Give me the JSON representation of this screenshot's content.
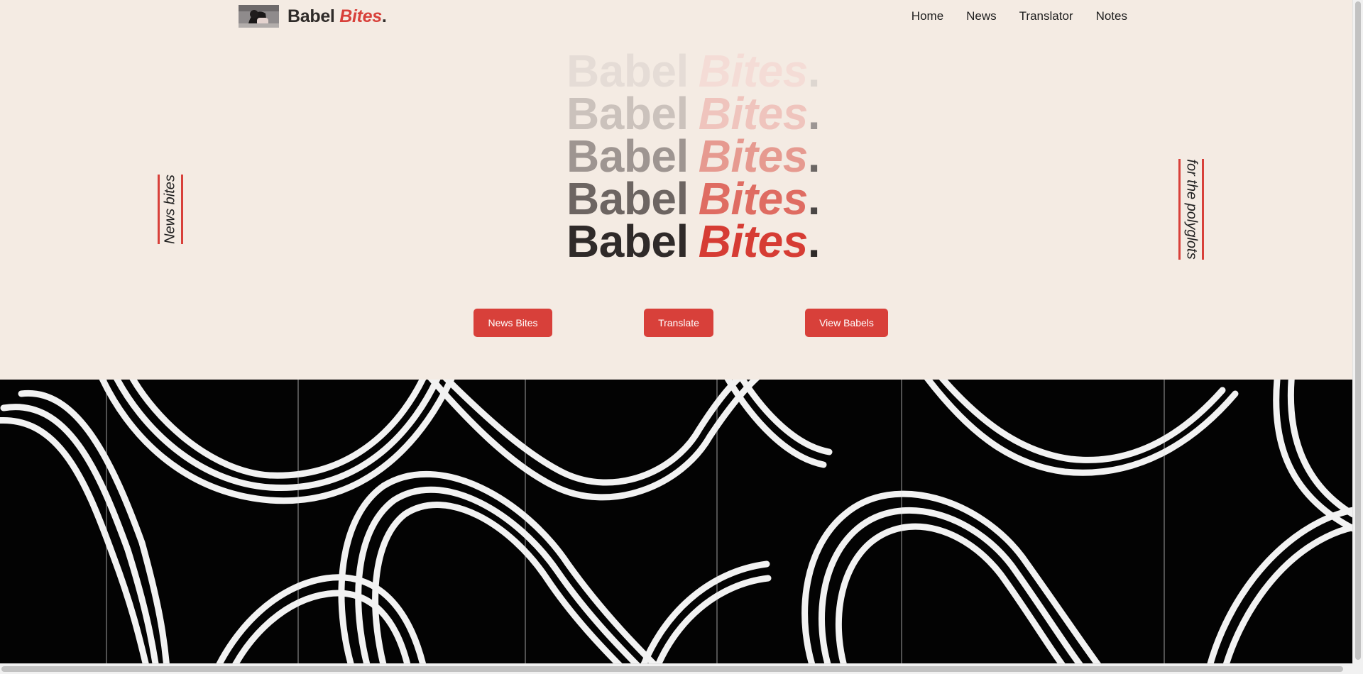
{
  "brand": {
    "name": "Babel",
    "accent": "Bites",
    "dot": "."
  },
  "nav": {
    "items": [
      "Home",
      "News",
      "Translator",
      "Notes"
    ]
  },
  "hero": {
    "word1": "Babel",
    "word2": "Bites",
    "dot": "."
  },
  "side_tags": {
    "left": "News bites",
    "right": "for the polyglots"
  },
  "buttons": {
    "news": "News Bites",
    "translate": "Translate",
    "babels": "View Babels"
  },
  "colors": {
    "accent": "#d8403a",
    "background": "#f4ebe3",
    "text": "#2f2b29"
  },
  "icons": {
    "logo_thumbnail": "cat-photo-thumbnail",
    "banner": "graffiti-pattern-image"
  }
}
